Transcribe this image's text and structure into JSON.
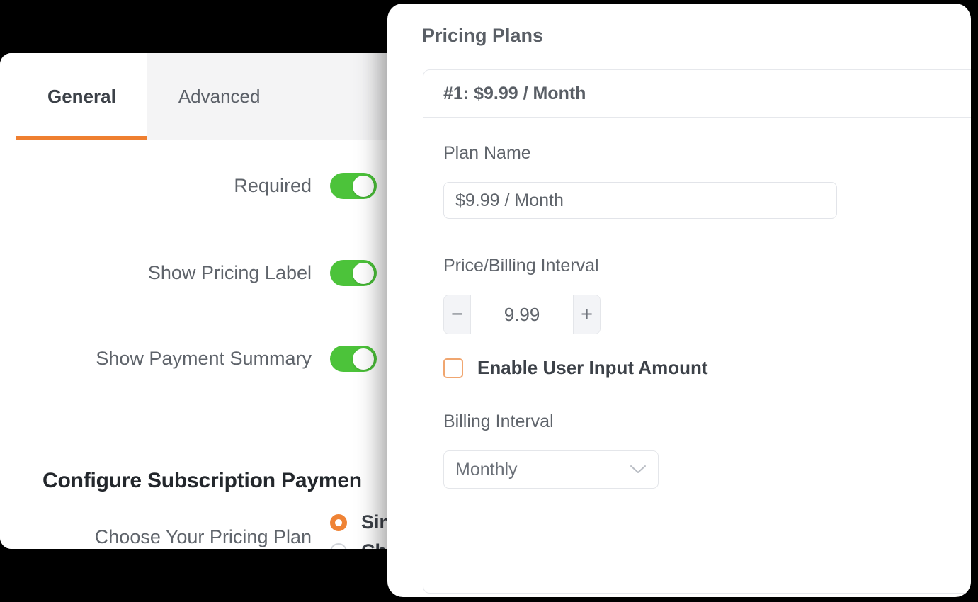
{
  "settings_panel": {
    "tabs": [
      {
        "label": "General",
        "active": true
      },
      {
        "label": "Advanced",
        "active": false
      }
    ],
    "fields": [
      {
        "label": "Required",
        "toggle_on": true
      },
      {
        "label": "Show Pricing Label",
        "toggle_on": true
      },
      {
        "label": "Show Payment Summary",
        "toggle_on": true
      }
    ],
    "section_heading": "Configure Subscription Paymen",
    "pricing_plan_row": {
      "label": "Choose Your Pricing Plan",
      "options": [
        {
          "text": "Sin",
          "selected": true
        },
        {
          "text": "Ch",
          "selected": false
        }
      ]
    }
  },
  "pricing_panel": {
    "title": "Pricing Plans",
    "plan_card": {
      "header": "#1: $9.99 / Month",
      "plan_name": {
        "label": "Plan Name",
        "value": "$9.99 / Month",
        "placeholder": "$9.99 / Month"
      },
      "price_interval": {
        "label": "Price/Billing Interval",
        "value": "9.99",
        "minus_label": "−",
        "plus_label": "+"
      },
      "enable_user_input": {
        "label": "Enable User Input Amount",
        "checked": false
      },
      "billing_interval": {
        "label": "Billing Interval",
        "value": "Monthly"
      }
    }
  },
  "colors": {
    "accent_orange": "#ef7f30",
    "toggle_green": "#4cc33a",
    "radio_orange": "#ef8335",
    "checkbox_orange": "#f0a670",
    "text_gray": "#5f646b",
    "heading_dark": "#23272c",
    "border_gray": "#e4e6ea",
    "backdrop": "#000000"
  }
}
